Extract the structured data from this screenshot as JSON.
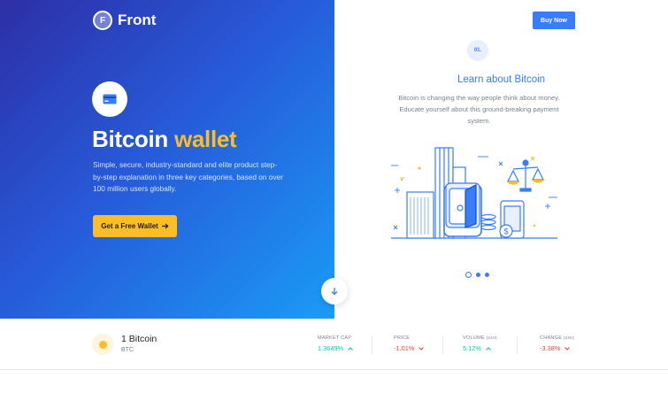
{
  "brand": {
    "logo_letter": "F",
    "name": "Front"
  },
  "hero": {
    "title_main": "Bitcoin",
    "title_accent": "wallet",
    "description": "Simple, secure, industry-standard and elite product step-by-step explanation in three key categories, based on over 100 million users globally.",
    "cta_label": "Get a Free Wallet",
    "cta_icon": "arrow-right-icon",
    "card_icon": "credit-card-icon",
    "scroll_icon": "arrow-down-icon"
  },
  "nav": {
    "buy_label": "Buy Now"
  },
  "slide": {
    "step": "01.",
    "title": "Learn about Bitcoin",
    "description": "Bitcoin is changing the way people think about money. Educate yourself about this ground-breaking payment system.",
    "total_slides": 3,
    "active_slide": 1
  },
  "ticker": {
    "name": "1 Bitcoin",
    "symbol": "BTC",
    "stats": [
      {
        "label": "MARKET CAP",
        "unit": "",
        "value": "1.3649%",
        "direction": "up"
      },
      {
        "label": "PRICE",
        "unit": "",
        "value": "-1.01%",
        "direction": "down"
      },
      {
        "label": "VOLUME",
        "unit": "(24H)",
        "value": "5.12%",
        "direction": "up"
      },
      {
        "label": "CHANGE",
        "unit": "(24H)",
        "value": "-3.38%",
        "direction": "down"
      }
    ]
  },
  "colors": {
    "primary": "#377dff",
    "accent": "#fdbd27",
    "up": "#00c9a7",
    "down": "#de4437"
  }
}
